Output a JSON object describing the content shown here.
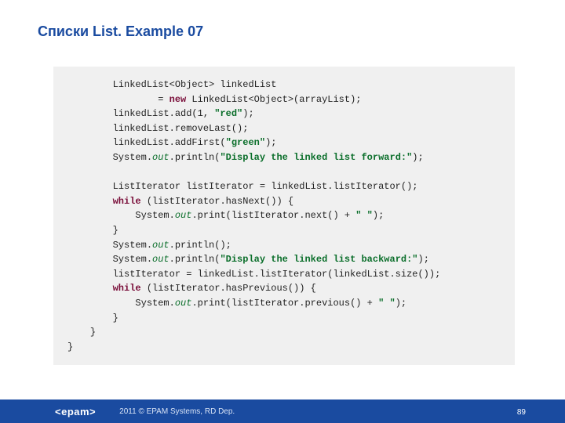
{
  "title": "Списки List. Example 07",
  "code": {
    "l1a": "LinkedList<Object> linkedList",
    "l2a": "        = ",
    "l2kw": "new",
    "l2b": " LinkedList<Object>(arrayList);",
    "l3a": "linkedList.add(1, ",
    "l3s": "\"red\"",
    "l3b": ");",
    "l4": "linkedList.removeLast();",
    "l5a": "linkedList.addFirst(",
    "l5s": "\"green\"",
    "l5b": ");",
    "l6a": "System.",
    "l6f": "out",
    "l6b": ".println(",
    "l6s": "\"Display the linked list forward:\"",
    "l6c": ");",
    "l8": "ListIterator listIterator = linkedList.listIterator();",
    "l9kw": "while",
    "l9a": " (listIterator.hasNext()) {",
    "l10a": "    System.",
    "l10f": "out",
    "l10b": ".print(listIterator.next() + ",
    "l10s": "\" \"",
    "l10c": ");",
    "l11": "}",
    "l12a": "System.",
    "l12f": "out",
    "l12b": ".println();",
    "l13a": "System.",
    "l13f": "out",
    "l13b": ".println(",
    "l13s": "\"Display the linked list backward:\"",
    "l13c": ");",
    "l14": "listIterator = linkedList.listIterator(linkedList.size());",
    "l15kw": "while",
    "l15a": " (listIterator.hasPrevious()) {",
    "l16a": "    System.",
    "l16f": "out",
    "l16b": ".print(listIterator.previous() + ",
    "l16s": "\" \"",
    "l16c": ");",
    "l17": "}",
    "l18": "}",
    "l19": "}"
  },
  "footer": {
    "logo": "<epam>",
    "copyright": "2011 © EPAM Systems, RD Dep.",
    "page": "89"
  }
}
